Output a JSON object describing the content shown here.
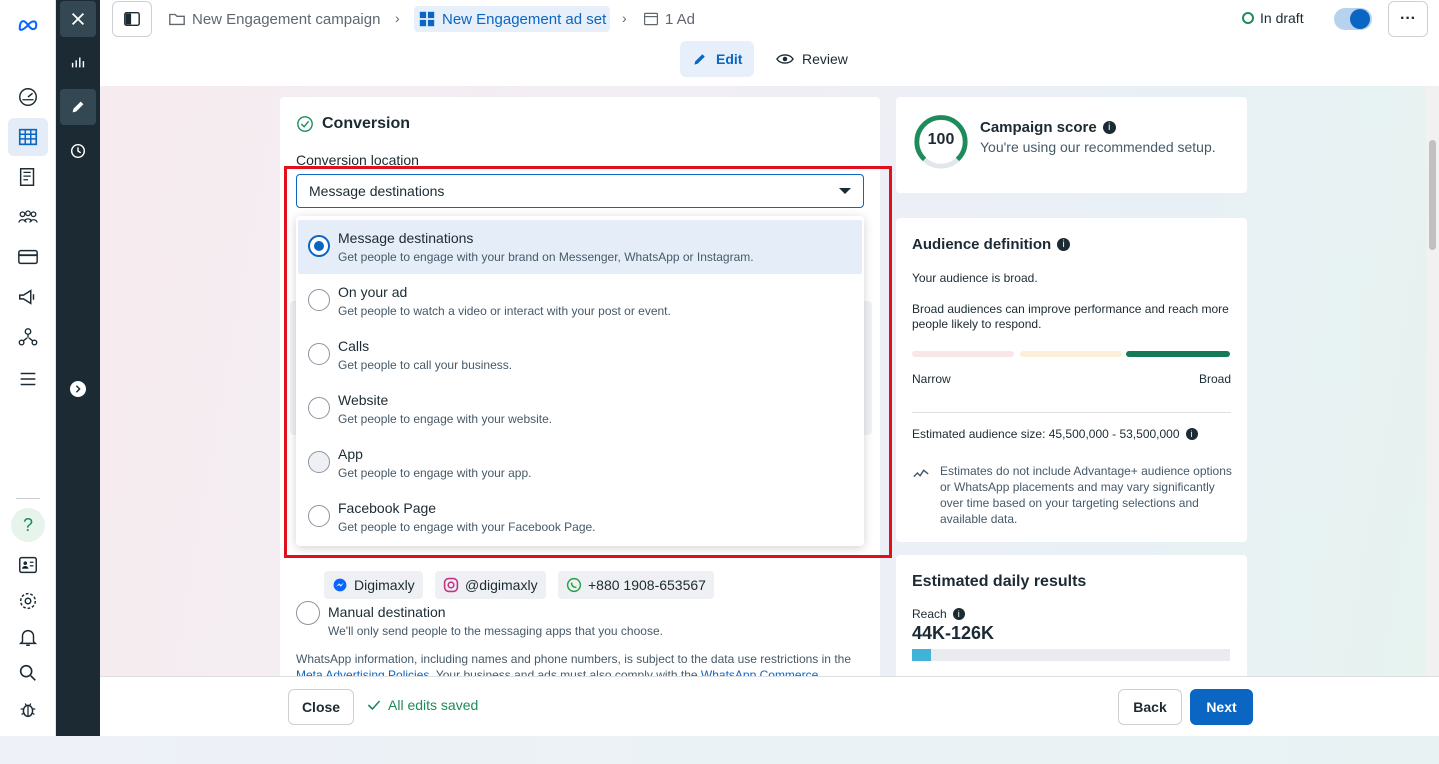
{
  "colors": {
    "accent": "#0a66c2",
    "dark": "#1c2b33",
    "success": "#1e8b5a",
    "highlight": "#e0111d"
  },
  "rail": {
    "icons": [
      "meta-logo-icon",
      "dashboard-gauge-icon",
      "campaigns-table-icon",
      "pages-icon",
      "audiences-icon",
      "billing-card-icon",
      "ad-megaphone-icon",
      "accounts-tree-icon",
      "menu-hamburger-icon",
      "help-icon",
      "contact-card-icon",
      "settings-gear-icon",
      "notifications-bell-icon",
      "search-icon",
      "bug-report-icon"
    ]
  },
  "topbar": {
    "breadcrumbs": [
      {
        "label": "New Engagement campaign",
        "icon": "folder-icon"
      },
      {
        "label": "New Engagement ad set",
        "icon": "grid-icon"
      },
      {
        "label": "1 Ad",
        "icon": "ad-frame-icon"
      }
    ],
    "status": "In draft",
    "more_label": "···"
  },
  "subbar": {
    "edit_label": "Edit",
    "review_label": "Review"
  },
  "conversion": {
    "heading": "Conversion",
    "location_label": "Conversion location",
    "selected_value": "Message destinations",
    "options": [
      {
        "label": "Message destinations",
        "desc": "Get people to engage with your brand on Messenger, WhatsApp or Instagram.",
        "selected": true
      },
      {
        "label": "On your ad",
        "desc": "Get people to watch a video or interact with your post or event."
      },
      {
        "label": "Calls",
        "desc": "Get people to call your business."
      },
      {
        "label": "Website",
        "desc": "Get people to engage with your website."
      },
      {
        "label": "App",
        "desc": "Get people to engage with your app."
      },
      {
        "label": "Facebook Page",
        "desc": "Get people to engage with your Facebook Page."
      }
    ],
    "chips": {
      "messenger": "Digimaxly",
      "instagram": "@digimaxly",
      "whatsapp": "+880 1908-653567"
    },
    "manual_label": "Manual destination",
    "manual_desc": "We'll only send people to the messaging apps that you choose.",
    "whatsapp_notice": "WhatsApp information, including names and phone numbers, is subject to the data use restrictions in",
    "whatsapp_notice_2_pre": "the",
    "whatsapp_link_1": "Meta Advertising Policies",
    "whatsapp_notice_2_mid": ". Your business and ads must also comply with the",
    "whatsapp_link_2": "WhatsApp Commerce"
  },
  "campaign_score": {
    "score": "100",
    "title": "Campaign score",
    "desc": "You're using our recommended setup."
  },
  "audience": {
    "title": "Audience definition",
    "broad_text": "Your audience is broad.",
    "broad_desc": "Broad audiences can improve performance and reach more people likely to respond.",
    "narrow_label": "Narrow",
    "broad_label": "Broad",
    "size_label": "Estimated audience size: 45,500,000 - 53,500,000",
    "estimate_note": "Estimates do not include Advantage+ audience options or WhatsApp placements and may vary significantly over time based on your targeting selections and available data."
  },
  "daily": {
    "title": "Estimated daily results",
    "reach_label": "Reach",
    "reach_value": "44K-126K",
    "reach_fill": 0.06
  },
  "footer": {
    "close_label": "Close",
    "saved_label": "All edits saved",
    "back_label": "Back",
    "next_label": "Next"
  }
}
